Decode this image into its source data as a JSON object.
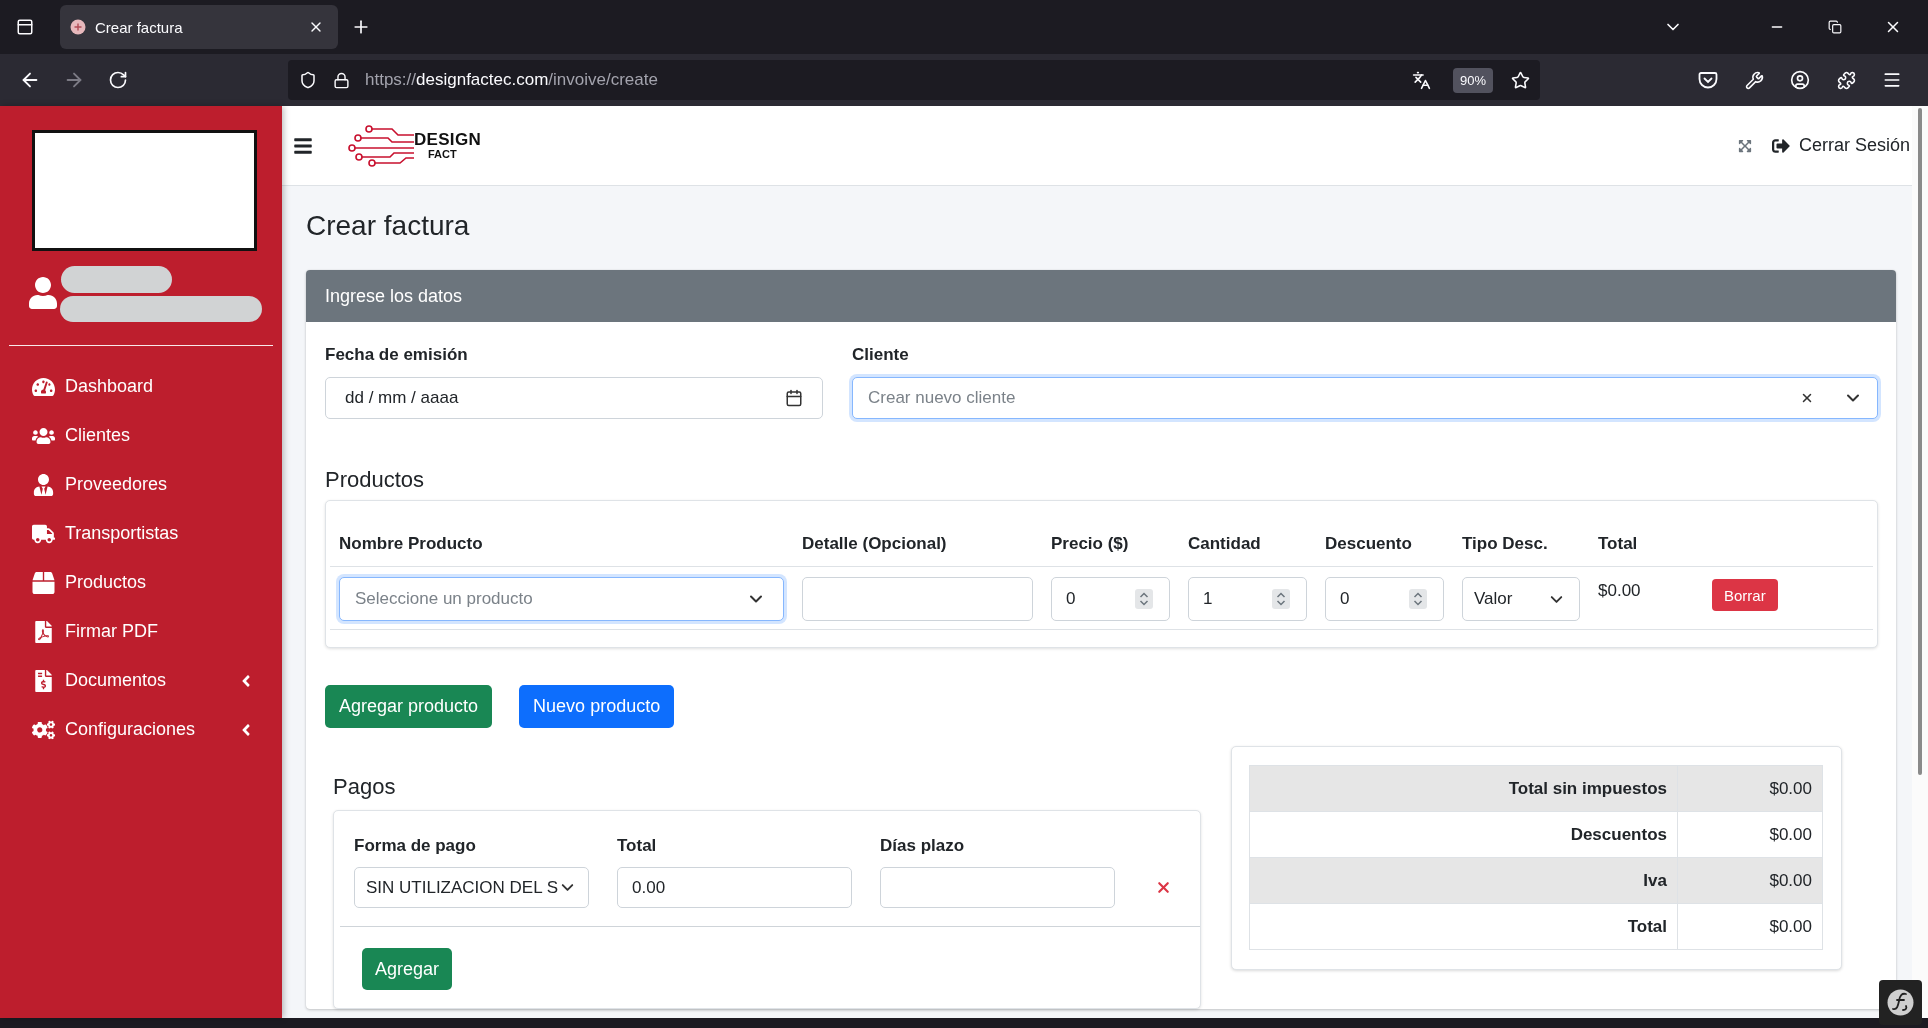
{
  "browser": {
    "tab_title": "Crear factura",
    "forward_disabled": true,
    "url": {
      "scheme": "https://",
      "host": "designfactec.com",
      "path": "/invoive/create"
    },
    "zoom": "90%"
  },
  "sidebar": {
    "items": [
      {
        "label": "Dashboard",
        "kind": "link"
      },
      {
        "label": "Clientes",
        "kind": "link"
      },
      {
        "label": "Proveedores",
        "kind": "link"
      },
      {
        "label": "Transportistas",
        "kind": "link"
      },
      {
        "label": "Productos",
        "kind": "link"
      },
      {
        "label": "Firmar PDF",
        "kind": "link"
      },
      {
        "label": "Documentos",
        "kind": "menu"
      },
      {
        "label": "Configuraciones",
        "kind": "menu"
      }
    ]
  },
  "header": {
    "logo": {
      "top": "DESIGN",
      "bottom": "FACT"
    },
    "logout": "Cerrar Sesión"
  },
  "page_title": "Crear factura",
  "form": {
    "title": "Ingrese los datos",
    "fields": [
      {
        "label": "Fecha de emisión",
        "kind": "date",
        "value": "dd / mm / aaaa",
        "focused": false
      },
      {
        "label": "Cliente",
        "kind": "select",
        "placeholder": "Crear nuevo cliente",
        "focused": true
      }
    ]
  },
  "products": {
    "title": "Productos",
    "columns": [
      "Nombre Producto",
      "Detalle (Opcional)",
      "Precio ($)",
      "Cantidad",
      "Descuento",
      "Tipo Desc.",
      "Total"
    ],
    "rows": [
      {
        "product": {
          "placeholder": "Seleccione un producto",
          "focused": true
        },
        "price": "0",
        "quantity": "1",
        "discount": "0",
        "discount_type": "Valor",
        "total": "$0.00",
        "action": "Borrar"
      }
    ]
  },
  "product_buttons": [
    {
      "label": "Agregar producto",
      "kind": "success"
    },
    {
      "label": "Nuevo producto",
      "kind": "primary"
    }
  ],
  "payments": {
    "title": "Pagos",
    "columns": [
      "Forma de pago",
      "Total",
      "Días plazo"
    ],
    "rows": [
      {
        "method": "SIN UTILIZACION DEL S",
        "total": "0.00"
      }
    ],
    "add": "Agregar"
  },
  "totals": [
    {
      "label": "Total sin impuestos",
      "value": "$0.00"
    },
    {
      "label": "Descuentos",
      "value": "$0.00"
    },
    {
      "label": "Iva",
      "value": "$0.00"
    },
    {
      "label": "Total",
      "value": "$0.00"
    }
  ]
}
